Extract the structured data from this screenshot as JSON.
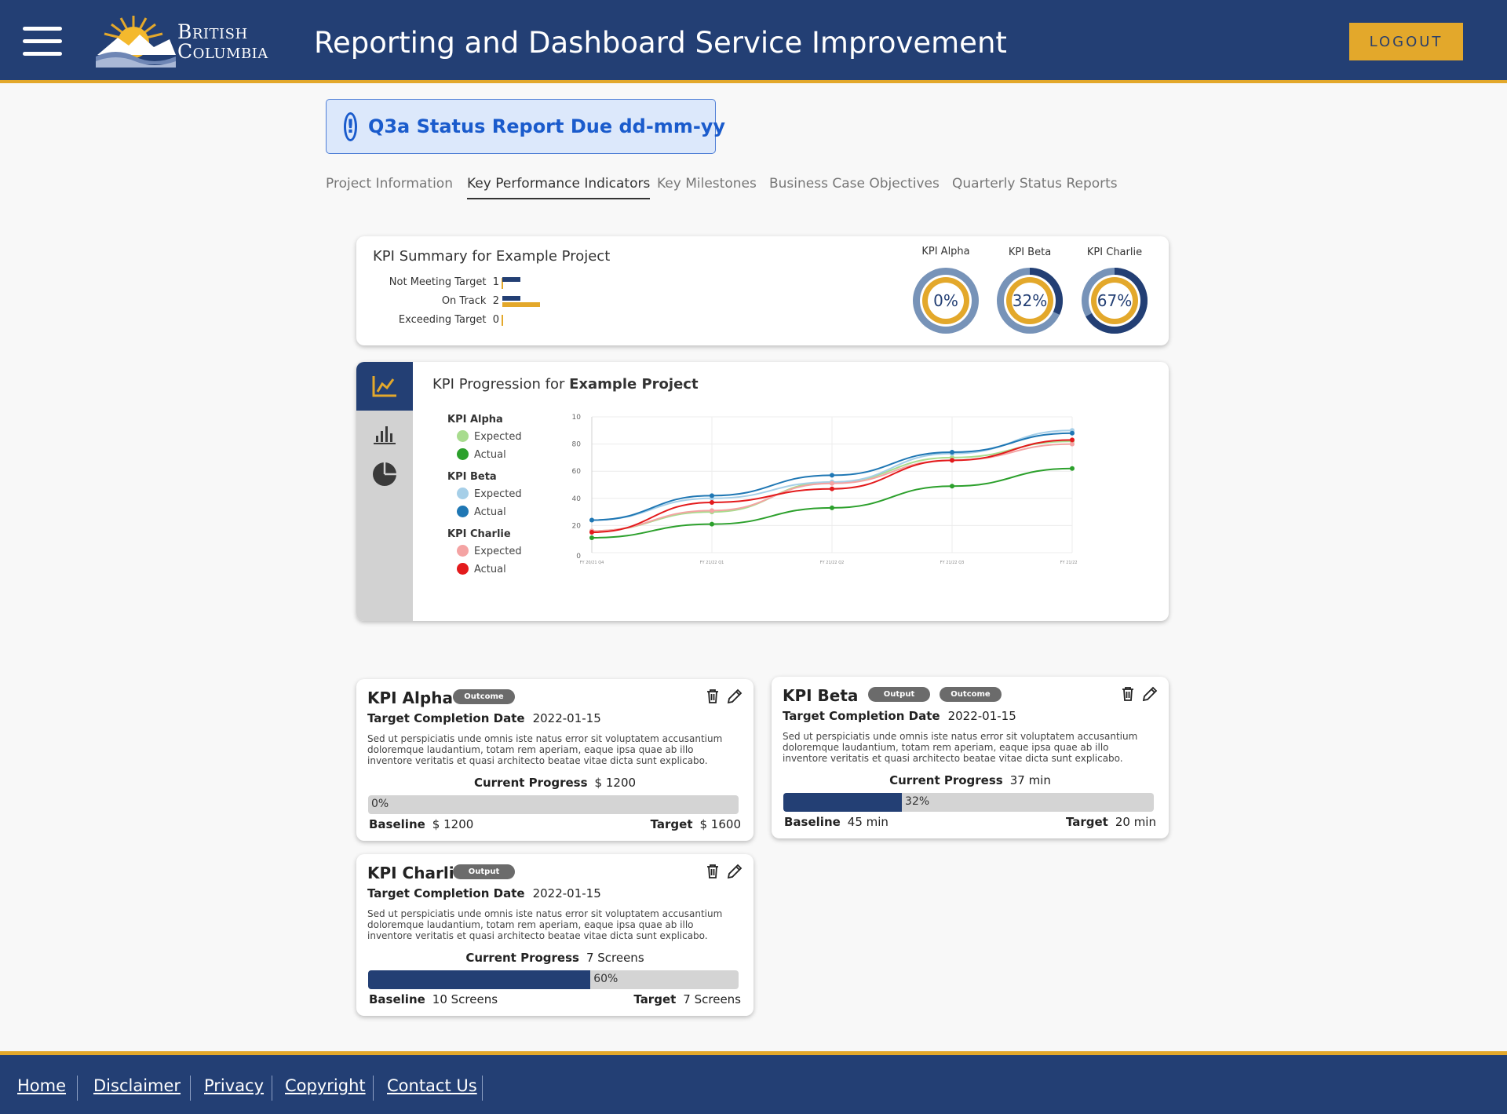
{
  "header": {
    "logo_line1": "British",
    "logo_line2": "Columbia",
    "title": "Reporting and Dashboard Service Improvement",
    "logout_label": "LOGOUT"
  },
  "alert": {
    "text": "Q3a Status Report Due dd-mm-yy"
  },
  "tabs": [
    {
      "label": "Project Information"
    },
    {
      "label": "Key Performance Indicators",
      "active": true
    },
    {
      "label": "Key Milestones"
    },
    {
      "label": "Business Case Objectives"
    },
    {
      "label": "Quarterly Status Reports"
    }
  ],
  "summary": {
    "title": "KPI Summary for Example Project",
    "rows": [
      {
        "label": "Not Meeting Target",
        "count": "1"
      },
      {
        "label": "On Track",
        "count": "2"
      },
      {
        "label": "Exceeding Target",
        "count": "0"
      }
    ],
    "donuts": [
      {
        "label": "KPI Alpha",
        "value_text": "0%",
        "value": 0
      },
      {
        "label": "KPI Beta",
        "value_text": "32%",
        "value": 32
      },
      {
        "label": "KPI Charlie",
        "value_text": "67%",
        "value": 67
      }
    ]
  },
  "progression": {
    "title_prefix": "KPI Progression for ",
    "title_bold": "Example Project",
    "legend": [
      {
        "group": "KPI Alpha",
        "items": [
          {
            "label": "Expected",
            "color": "#a8dc8e"
          },
          {
            "label": "Actual",
            "color": "#2ca02c"
          }
        ]
      },
      {
        "group": "KPI Beta",
        "items": [
          {
            "label": "Expected",
            "color": "#a6cfe8"
          },
          {
            "label": "Actual",
            "color": "#1f77b4"
          }
        ]
      },
      {
        "group": "KPI Charlie",
        "items": [
          {
            "label": "Expected",
            "color": "#f4a3a3"
          },
          {
            "label": "Actual",
            "color": "#e31a1c"
          }
        ]
      }
    ]
  },
  "chart_data": {
    "type": "line",
    "x": [
      "FY 20/21 Q4",
      "FY 21/22 Q1",
      "FY 21/22 Q2",
      "FY 21/22 Q3",
      "FY 21/22 Q4"
    ],
    "yticks": [
      "0",
      "20",
      "40",
      "60",
      "80",
      "10"
    ],
    "ylim": [
      0,
      100
    ],
    "series": [
      {
        "name": "KPI Alpha Expected",
        "color": "#a8dc8e",
        "values": [
          16,
          30,
          52,
          70,
          82
        ]
      },
      {
        "name": "KPI Alpha Actual",
        "color": "#2ca02c",
        "values": [
          11,
          21,
          33,
          49,
          62
        ]
      },
      {
        "name": "KPI Beta Expected",
        "color": "#a6cfe8",
        "values": [
          24,
          40,
          52,
          73,
          90
        ]
      },
      {
        "name": "KPI Beta Actual",
        "color": "#1f77b4",
        "values": [
          24,
          42,
          57,
          74,
          88
        ]
      },
      {
        "name": "KPI Charlie Expected",
        "color": "#f4a3a3",
        "values": [
          16,
          31,
          51,
          68,
          80
        ]
      },
      {
        "name": "KPI Charlie Actual",
        "color": "#e31a1c",
        "values": [
          15,
          37,
          47,
          68,
          83
        ]
      }
    ],
    "grid": true
  },
  "kpis": [
    {
      "name": "KPI Alpha",
      "tags": [
        "Outcome"
      ],
      "tcd_label": "Target Completion Date",
      "tcd_value": "2022-01-15",
      "description": "Sed ut perspiciatis unde omnis iste natus error sit voluptatem accusantium doloremque laudantium, totam rem aperiam, eaque ipsa quae ab illo inventore veritatis et quasi architecto beatae vitae dicta sunt explicabo.",
      "current_label": "Current Progress",
      "current_value": "$ 1200",
      "progress_text": "0%",
      "progress": 0,
      "baseline_label": "Baseline",
      "baseline_value": "$ 1200",
      "target_label": "Target",
      "target_value": "$ 1600"
    },
    {
      "name": "KPI Beta",
      "tags": [
        "Output",
        "Outcome"
      ],
      "tcd_label": "Target Completion Date",
      "tcd_value": "2022-01-15",
      "description": "Sed ut perspiciatis unde omnis iste natus error sit voluptatem accusantium doloremque laudantium, totam rem aperiam, eaque ipsa quae ab illo inventore veritatis et quasi architecto beatae vitae dicta sunt explicabo.",
      "current_label": "Current Progress",
      "current_value": "37 min",
      "progress_text": "32%",
      "progress": 32,
      "baseline_label": "Baseline",
      "baseline_value": "45 min",
      "target_label": "Target",
      "target_value": "20 min"
    },
    {
      "name": "KPI Charlie",
      "tags": [
        "Output"
      ],
      "tcd_label": "Target Completion Date",
      "tcd_value": "2022-01-15",
      "description": "Sed ut perspiciatis unde omnis iste natus error sit voluptatem accusantium doloremque laudantium, totam rem aperiam, eaque ipsa quae ab illo inventore veritatis et quasi architecto beatae vitae dicta sunt explicabo.",
      "current_label": "Current Progress",
      "current_value": "7 Screens",
      "progress_text": "60%",
      "progress": 60,
      "baseline_label": "Baseline",
      "baseline_value": "10 Screens",
      "target_label": "Target",
      "target_value": "7 Screens"
    }
  ],
  "footer": {
    "links": [
      "Home",
      "Disclaimer",
      "Privacy",
      "Copyright",
      "Contact Us"
    ]
  },
  "colors": {
    "brand": "#233f74",
    "accent": "#e3a82b",
    "alert": "#1a5bcc"
  }
}
